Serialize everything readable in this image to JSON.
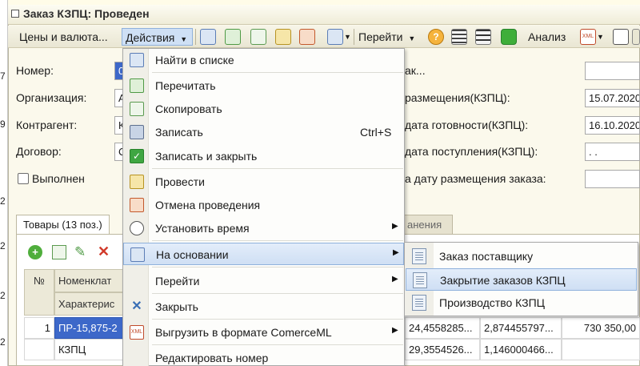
{
  "window": {
    "title": "Заказ КЗПЦ: Проведен"
  },
  "left_strip": [
    "7",
    "9",
    "2",
    "2",
    "2",
    "2"
  ],
  "toolbar": {
    "prices_label": "Цены и валюта...",
    "actions_label": "Действия",
    "goto_label": "Перейти",
    "analysis_label": "Анализ"
  },
  "form": {
    "number_label": "Номер:",
    "number_value": "0",
    "org_label": "Организация:",
    "org_value": "А",
    "contractor_label": "Контрагент:",
    "contractor_value": "К",
    "contract_label": "Договор:",
    "contract_value": "С",
    "done_label": "Выполнен",
    "right_labels": [
      "ак...",
      "размещения(КЗПЦ):",
      "дата готовности(КЗПЦ):",
      "дата поступления(КЗПЦ):",
      "а дату размещения заказа:"
    ],
    "right_values": [
      "",
      "15.07.2020",
      "16.10.2020",
      " .  .",
      ""
    ]
  },
  "tabs": {
    "goods": "Товары (13 поз.)",
    "other": "анения"
  },
  "grid": {
    "headers": {
      "num": "№",
      "nomenclature": "Номенклат",
      "characteristic": "Характерис"
    },
    "rows": [
      {
        "num": "1",
        "name": "ПР-15,875-2",
        "c1": "24,4558285...",
        "c2": "2,874455797...",
        "c3": "730 350,00"
      },
      {
        "num": "",
        "name": "КЗПЦ",
        "c1": "29,3554526...",
        "c2": "1,146000466...",
        "c3": ""
      }
    ]
  },
  "menu": {
    "items": [
      {
        "label": "Найти в списке",
        "icon": "find-in-list-icon"
      },
      {
        "label": "Перечитать",
        "icon": "refresh-icon"
      },
      {
        "label": "Скопировать",
        "icon": "copy-icon"
      },
      {
        "label": "Записать",
        "icon": "save-icon",
        "shortcut": "Ctrl+S"
      },
      {
        "label": "Записать и закрыть",
        "icon": "save-close-icon"
      },
      {
        "label": "Провести",
        "icon": "post-icon"
      },
      {
        "label": "Отмена проведения",
        "icon": "unpost-icon"
      },
      {
        "label": "Установить время",
        "icon": "clock-icon"
      },
      {
        "label": "На основании",
        "icon": "based-on-icon"
      },
      {
        "label": "Перейти",
        "icon": ""
      },
      {
        "label": "Закрыть",
        "icon": "close-icon"
      },
      {
        "label": "Выгрузить в формате ComerceML",
        "icon": "xml-export-icon"
      },
      {
        "label": "Редактировать номер",
        "icon": ""
      }
    ]
  },
  "submenu": {
    "items": [
      {
        "label": "Заказ поставщику"
      },
      {
        "label": "Закрытие заказов КЗПЦ"
      },
      {
        "label": "Производство КЗПЦ"
      }
    ]
  },
  "colors": {
    "highlight": "#cfdff4",
    "selected_cell": "#3d68c9",
    "window_bg": "#fbf9ec"
  }
}
